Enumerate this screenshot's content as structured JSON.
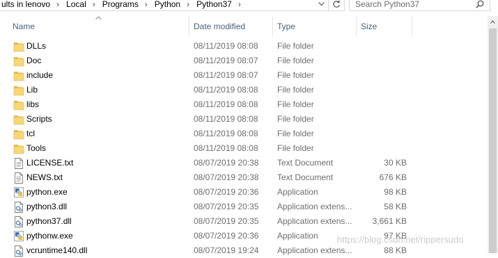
{
  "breadcrumb": {
    "items": [
      "ults in lenovo",
      "Local",
      "Programs",
      "Python",
      "Python37"
    ]
  },
  "search": {
    "placeholder": "Search Python37"
  },
  "columns": {
    "name": "Name",
    "date": "Date modified",
    "type": "Type",
    "size": "Size"
  },
  "files": [
    {
      "name": "DLLs",
      "date": "08/11/2019 08:08",
      "type": "File folder",
      "size": "",
      "icon": "folder-icon"
    },
    {
      "name": "Doc",
      "date": "08/11/2019 08:07",
      "type": "File folder",
      "size": "",
      "icon": "folder-icon"
    },
    {
      "name": "include",
      "date": "08/11/2019 08:07",
      "type": "File folder",
      "size": "",
      "icon": "folder-icon"
    },
    {
      "name": "Lib",
      "date": "08/11/2019 08:08",
      "type": "File folder",
      "size": "",
      "icon": "folder-icon"
    },
    {
      "name": "libs",
      "date": "08/11/2019 08:08",
      "type": "File folder",
      "size": "",
      "icon": "folder-icon"
    },
    {
      "name": "Scripts",
      "date": "08/11/2019 08:08",
      "type": "File folder",
      "size": "",
      "icon": "folder-icon"
    },
    {
      "name": "tcl",
      "date": "08/11/2019 08:08",
      "type": "File folder",
      "size": "",
      "icon": "folder-icon"
    },
    {
      "name": "Tools",
      "date": "08/11/2019 08:08",
      "type": "File folder",
      "size": "",
      "icon": "folder-icon"
    },
    {
      "name": "LICENSE.txt",
      "date": "08/07/2019 20:38",
      "type": "Text Document",
      "size": "30 KB",
      "icon": "text-file-icon"
    },
    {
      "name": "NEWS.txt",
      "date": "08/07/2019 20:38",
      "type": "Text Document",
      "size": "676 KB",
      "icon": "text-file-icon"
    },
    {
      "name": "python.exe",
      "date": "08/07/2019 20:36",
      "type": "Application",
      "size": "98 KB",
      "icon": "python-exe-icon"
    },
    {
      "name": "python3.dll",
      "date": "08/07/2019 20:35",
      "type": "Application extens...",
      "size": "58 KB",
      "icon": "dll-file-icon"
    },
    {
      "name": "python37.dll",
      "date": "08/07/2019 20:35",
      "type": "Application extens...",
      "size": "3,661 KB",
      "icon": "dll-file-icon"
    },
    {
      "name": "pythonw.exe",
      "date": "08/07/2019 20:36",
      "type": "Application",
      "size": "97 KB",
      "icon": "python-exe-icon"
    },
    {
      "name": "vcruntime140.dll",
      "date": "08/07/2019 19:24",
      "type": "Application extens...",
      "size": "88 KB",
      "icon": "dll-file-icon"
    }
  ],
  "watermark": "https://blog.csdn.net/rippersudo",
  "colors": {
    "folder": "#f8d775",
    "header_text": "#4c607a",
    "secondary_text": "#6d6d6d"
  }
}
